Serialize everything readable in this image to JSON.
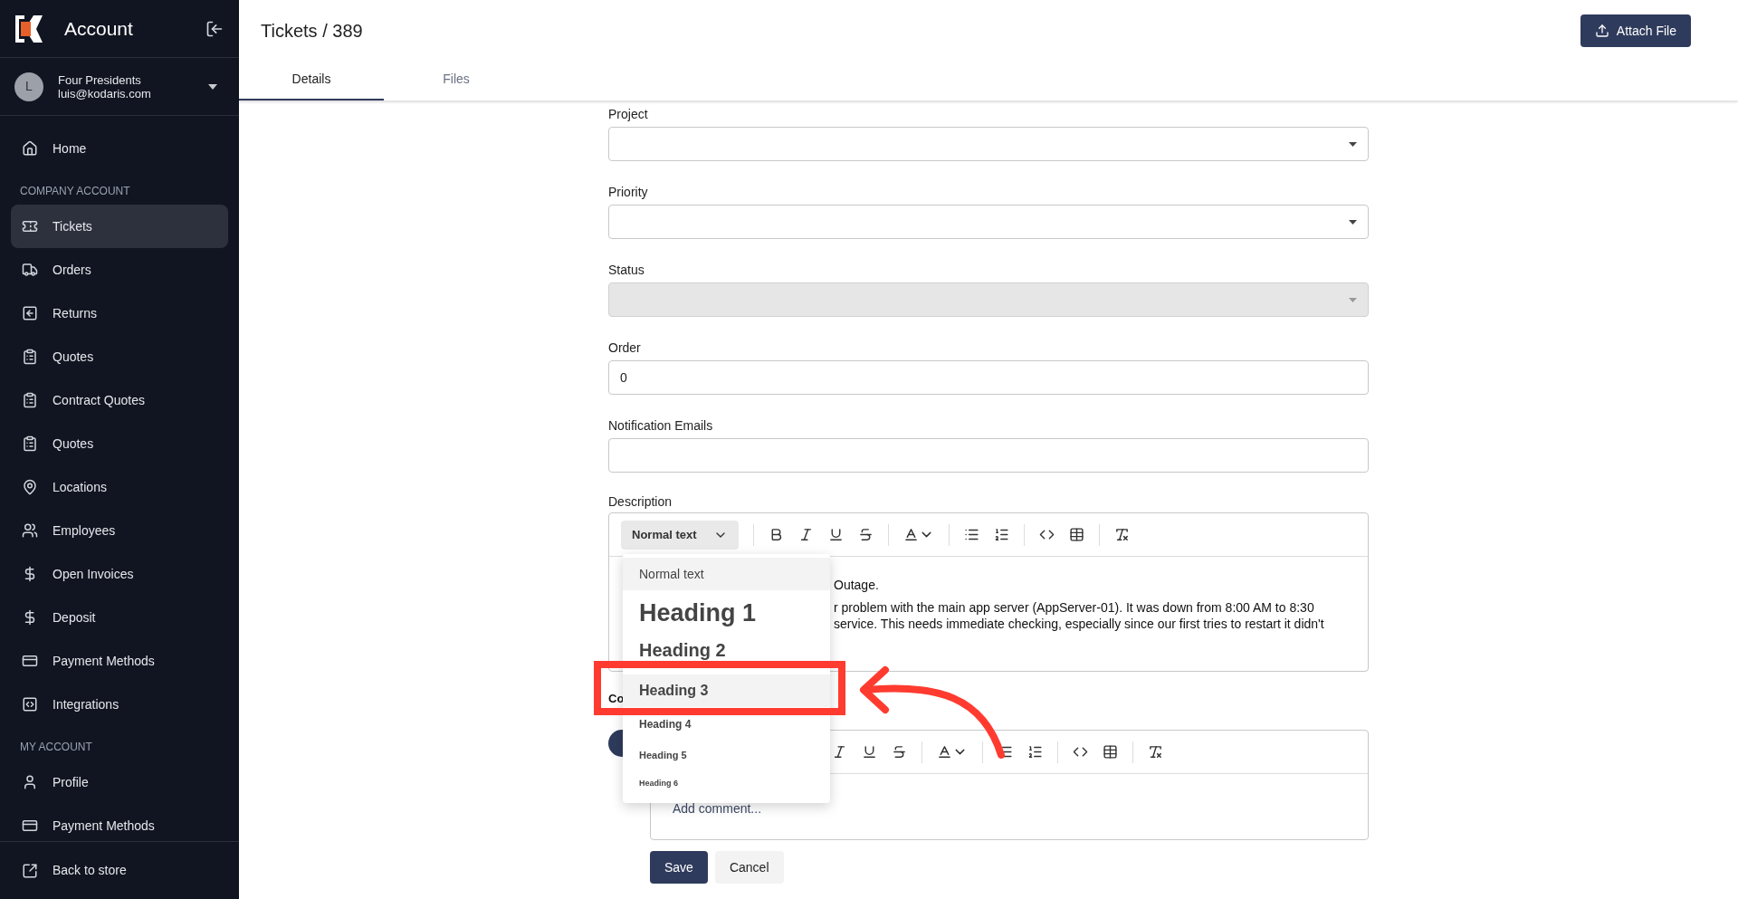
{
  "sidebar": {
    "title": "Account",
    "user": {
      "initial": "L",
      "name": "Four Presidents",
      "email": "luis@kodaris.com"
    },
    "top_items": [
      {
        "label": "Home",
        "selected": false
      }
    ],
    "sections": [
      {
        "heading": "COMPANY ACCOUNT",
        "items": [
          {
            "label": "Tickets",
            "selected": true
          },
          {
            "label": "Orders",
            "selected": false
          },
          {
            "label": "Returns",
            "selected": false
          },
          {
            "label": "Quotes",
            "selected": false
          },
          {
            "label": "Contract Quotes",
            "selected": false
          },
          {
            "label": "Quotes",
            "selected": false
          },
          {
            "label": "Locations",
            "selected": false
          },
          {
            "label": "Employees",
            "selected": false
          },
          {
            "label": "Open Invoices",
            "selected": false
          },
          {
            "label": "Deposit",
            "selected": false
          },
          {
            "label": "Payment Methods",
            "selected": false
          },
          {
            "label": "Integrations",
            "selected": false
          }
        ]
      },
      {
        "heading": "MY ACCOUNT",
        "items": [
          {
            "label": "Profile",
            "selected": false
          },
          {
            "label": "Payment Methods",
            "selected": false
          }
        ]
      }
    ],
    "footer": "Back to store"
  },
  "header": {
    "title": "Tickets / 389",
    "button": "Attach File"
  },
  "tabs": [
    {
      "label": "Details",
      "selected": true
    },
    {
      "label": "Files",
      "selected": false
    }
  ],
  "fields": [
    {
      "label": "Project",
      "kind": "select",
      "disabled": false
    },
    {
      "label": "Priority",
      "kind": "select",
      "disabled": false
    },
    {
      "label": "Status",
      "kind": "select",
      "disabled": true
    },
    {
      "label": "Order",
      "kind": "input",
      "value": "0",
      "disabled": false
    },
    {
      "label": "Notification Emails",
      "kind": "input",
      "disabled": false
    }
  ],
  "description": {
    "label": "Description",
    "style_select": "Normal text",
    "lines": [
      "Outage.",
      "r problem with the main app server (AppServer-01). It was down from 8:00 AM to 8:30",
      "service. This needs immediate checking, especially since our first tries to restart it didn't"
    ]
  },
  "style_menu": [
    {
      "label": "Normal text",
      "kind": "normal",
      "highlighted": true
    },
    {
      "label": "Heading 1",
      "kind": "h1",
      "highlighted": false
    },
    {
      "label": "Heading 2",
      "kind": "h2",
      "highlighted": false
    },
    {
      "label": "Heading 3",
      "kind": "h3",
      "highlighted": true
    },
    {
      "label": "Heading 4",
      "kind": "h4",
      "highlighted": false
    },
    {
      "label": "Heading 5",
      "kind": "h5",
      "highlighted": false
    },
    {
      "label": "Heading 6",
      "kind": "h6",
      "highlighted": false
    }
  ],
  "comments": {
    "label": "Co",
    "placeholder": "Add comment...",
    "buttons": [
      "Save",
      "Cancel"
    ]
  }
}
